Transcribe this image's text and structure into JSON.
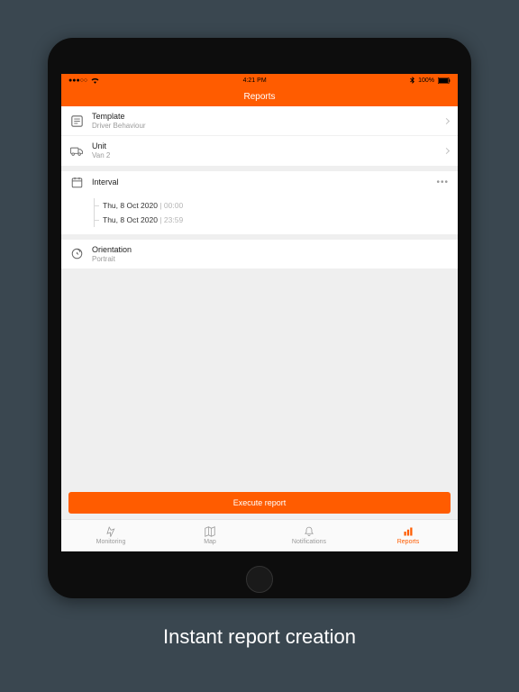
{
  "status_bar": {
    "time": "4:21 PM",
    "battery_text": "100%"
  },
  "nav": {
    "title": "Reports"
  },
  "rows": {
    "template": {
      "title": "Template",
      "value": "Driver Behaviour"
    },
    "unit": {
      "title": "Unit",
      "value": "Van 2"
    },
    "interval": {
      "title": "Interval",
      "from_date": "Thu, 8 Oct 2020",
      "from_time": "00:00",
      "to_date": "Thu, 8 Oct 2020",
      "to_time": "23:59"
    },
    "orientation": {
      "title": "Orientation",
      "value": "Portrait"
    }
  },
  "execute_label": "Execute report",
  "tabs": {
    "monitoring": "Monitoring",
    "map": "Map",
    "notifications": "Notifications",
    "reports": "Reports"
  },
  "caption": "Instant report creation"
}
